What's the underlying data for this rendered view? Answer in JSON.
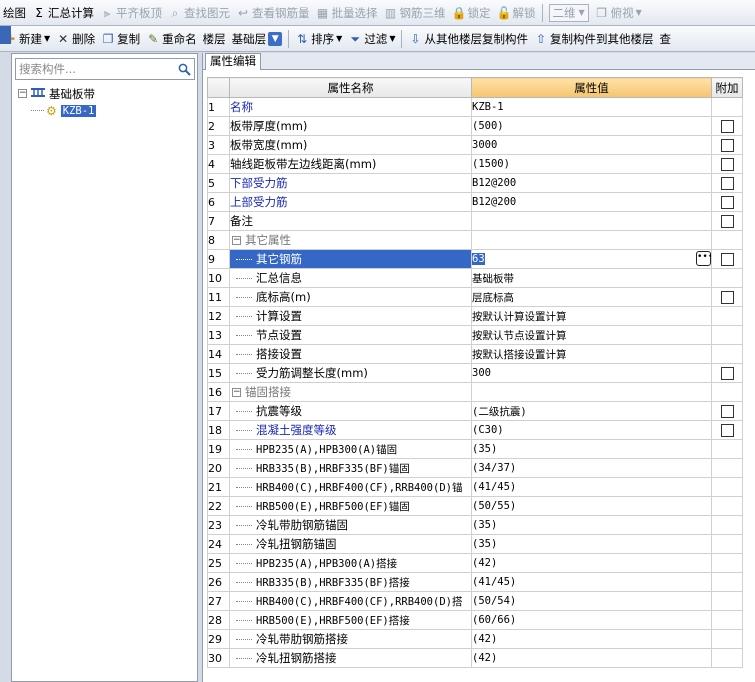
{
  "toolbar1": {
    "items": [
      {
        "label": "绘图",
        "icon": "draw-icon",
        "disabled": false
      },
      {
        "label": "汇总计算",
        "icon": "sigma-icon",
        "disabled": false
      },
      {
        "label": "平齐板顶",
        "icon": "align-slab-icon",
        "disabled": true
      },
      {
        "label": "查找图元",
        "icon": "find-icon",
        "disabled": true
      },
      {
        "label": "查看钢筋量",
        "icon": "view-rebar-icon",
        "disabled": true
      },
      {
        "label": "批量选择",
        "icon": "batch-select-icon",
        "disabled": true
      },
      {
        "label": "钢筋三维",
        "icon": "rebar-3d-icon",
        "disabled": true
      },
      {
        "label": "锁定",
        "icon": "lock-icon",
        "disabled": true
      },
      {
        "label": "解锁",
        "icon": "unlock-icon",
        "disabled": true
      }
    ],
    "view_mode": "二维",
    "view_angle": "俯视"
  },
  "toolbar2": {
    "new_label": "新建",
    "delete_label": "删除",
    "copy_label": "复制",
    "rename_label": "重命名",
    "floor_label": "楼层",
    "floor_value": "基础层",
    "sort_label": "排序",
    "filter_label": "过滤",
    "copy_from_label": "从其他楼层复制构件",
    "copy_to_label": "复制构件到其他楼层",
    "trailing_label": "查"
  },
  "left": {
    "search_placeholder": "搜索构件...",
    "tree_root": "基础板带",
    "tree_root_expand": "−",
    "tree_child": "KZB-1"
  },
  "tab": "属性编辑",
  "grid": {
    "headers": {
      "name": "属性名称",
      "value": "属性值",
      "extra": "附加"
    },
    "rows": [
      {
        "no": "1",
        "name": "名称",
        "value": "KZB-1",
        "style": "blue",
        "indent": false,
        "cb": false
      },
      {
        "no": "2",
        "name": "板带厚度(mm)",
        "value": "(500)",
        "style": "normal",
        "indent": false,
        "cb": true
      },
      {
        "no": "3",
        "name": "板带宽度(mm)",
        "value": "3000",
        "style": "normal",
        "indent": false,
        "cb": true
      },
      {
        "no": "4",
        "name": "轴线距板带左边线距离(mm)",
        "value": "(1500)",
        "style": "normal",
        "indent": false,
        "cb": true
      },
      {
        "no": "5",
        "name": "下部受力筋",
        "value": "B12@200",
        "style": "blue",
        "indent": false,
        "cb": true
      },
      {
        "no": "6",
        "name": "上部受力筋",
        "value": "B12@200",
        "style": "blue",
        "indent": false,
        "cb": true
      },
      {
        "no": "7",
        "name": "备注",
        "value": "",
        "style": "normal",
        "indent": false,
        "cb": true
      },
      {
        "no": "8",
        "name": "其它属性",
        "value": "",
        "style": "group",
        "indent": false,
        "cb": false
      },
      {
        "no": "9",
        "name": "其它钢筋",
        "value": "63",
        "style": "normal",
        "indent": true,
        "cb": true,
        "selected": true
      },
      {
        "no": "10",
        "name": "汇总信息",
        "value": "基础板带",
        "style": "normal",
        "indent": true,
        "cb": false
      },
      {
        "no": "11",
        "name": "底标高(m)",
        "value": "层底标高",
        "style": "normal",
        "indent": true,
        "cb": true
      },
      {
        "no": "12",
        "name": "计算设置",
        "value": "按默认计算设置计算",
        "style": "normal",
        "indent": true,
        "cb": false
      },
      {
        "no": "13",
        "name": "节点设置",
        "value": "按默认节点设置计算",
        "style": "normal",
        "indent": true,
        "cb": false
      },
      {
        "no": "14",
        "name": "搭接设置",
        "value": "按默认搭接设置计算",
        "style": "normal",
        "indent": true,
        "cb": false
      },
      {
        "no": "15",
        "name": "受力筋调整长度(mm)",
        "value": "300",
        "style": "normal",
        "indent": true,
        "cb": true
      },
      {
        "no": "16",
        "name": "锚固搭接",
        "value": "",
        "style": "group",
        "indent": false,
        "cb": false
      },
      {
        "no": "17",
        "name": "抗震等级",
        "value": "(二级抗震)",
        "style": "normal",
        "indent": true,
        "cb": true
      },
      {
        "no": "18",
        "name": "混凝土强度等级",
        "value": "(C30)",
        "style": "blue",
        "indent": true,
        "cb": true
      },
      {
        "no": "19",
        "name": "HPB235(A),HPB300(A)锚固",
        "value": "(35)",
        "style": "normal",
        "indent": true,
        "cb": false
      },
      {
        "no": "20",
        "name": "HRB335(B),HRBF335(BF)锚固",
        "value": "(34/37)",
        "style": "normal",
        "indent": true,
        "cb": false
      },
      {
        "no": "21",
        "name": "HRB400(C),HRBF400(CF),RRB400(D)锚",
        "value": "(41/45)",
        "style": "normal",
        "indent": true,
        "cb": false
      },
      {
        "no": "22",
        "name": "HRB500(E),HRBF500(EF)锚固",
        "value": "(50/55)",
        "style": "normal",
        "indent": true,
        "cb": false
      },
      {
        "no": "23",
        "name": "冷轧带肋钢筋锚固",
        "value": "(35)",
        "style": "normal",
        "indent": true,
        "cb": false
      },
      {
        "no": "24",
        "name": "冷轧扭钢筋锚固",
        "value": "(35)",
        "style": "normal",
        "indent": true,
        "cb": false
      },
      {
        "no": "25",
        "name": "HPB235(A),HPB300(A)搭接",
        "value": "(42)",
        "style": "normal",
        "indent": true,
        "cb": false
      },
      {
        "no": "26",
        "name": "HRB335(B),HRBF335(BF)搭接",
        "value": "(41/45)",
        "style": "normal",
        "indent": true,
        "cb": false
      },
      {
        "no": "27",
        "name": "HRB400(C),HRBF400(CF),RRB400(D)搭",
        "value": "(50/54)",
        "style": "normal",
        "indent": true,
        "cb": false
      },
      {
        "no": "28",
        "name": "HRB500(E),HRBF500(EF)搭接",
        "value": "(60/66)",
        "style": "normal",
        "indent": true,
        "cb": false
      },
      {
        "no": "29",
        "name": "冷轧带肋钢筋搭接",
        "value": "(42)",
        "style": "normal",
        "indent": true,
        "cb": false
      },
      {
        "no": "30",
        "name": "冷轧扭钢筋搭接",
        "value": "(42)",
        "style": "normal",
        "indent": true,
        "cb": false
      }
    ]
  }
}
